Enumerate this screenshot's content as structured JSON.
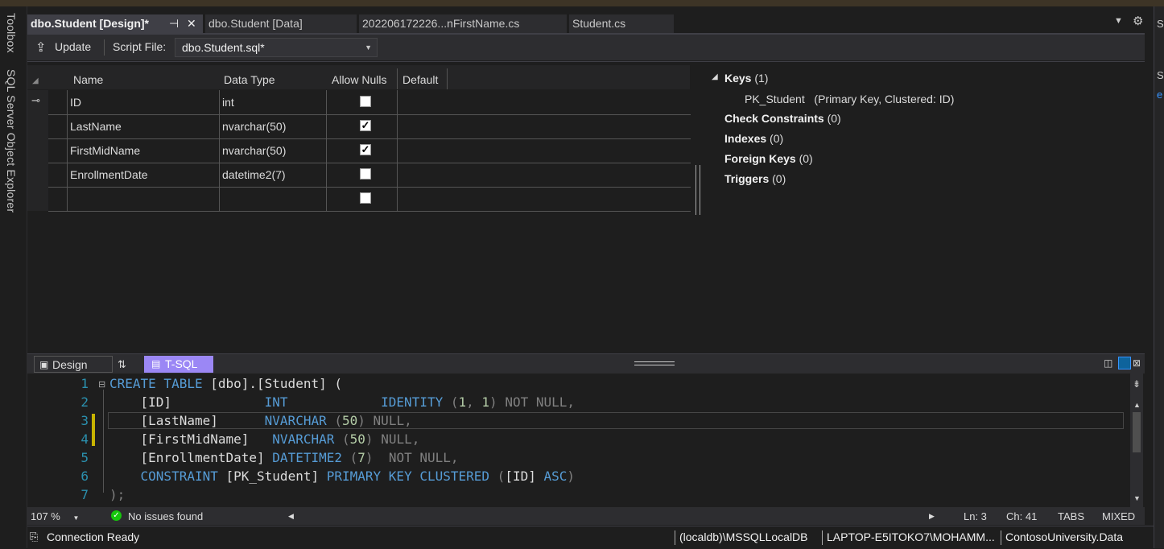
{
  "sidebar_left": {
    "toolbox": "Toolbox",
    "sql_explorer": "SQL Server Object Explorer"
  },
  "tabs": [
    {
      "label": "dbo.Student [Design]*"
    },
    {
      "label": "dbo.Student [Data]"
    },
    {
      "label": "202206172226...nFirstName.cs"
    },
    {
      "label": "Student.cs"
    }
  ],
  "toolbar": {
    "update_label": "Update",
    "script_file_label": "Script File:",
    "script_file_value": "dbo.Student.sql*"
  },
  "grid": {
    "columns": [
      "Name",
      "Data Type",
      "Allow Nulls",
      "Default"
    ],
    "rows": [
      {
        "name": "ID",
        "type": "int",
        "allow_nulls": false,
        "key": true
      },
      {
        "name": "LastName",
        "type": "nvarchar(50)",
        "allow_nulls": true
      },
      {
        "name": "FirstMidName",
        "type": "nvarchar(50)",
        "allow_nulls": true
      },
      {
        "name": "EnrollmentDate",
        "type": "datetime2(7)",
        "allow_nulls": false
      },
      {
        "name": "",
        "type": "",
        "allow_nulls": false
      }
    ]
  },
  "properties": {
    "keys_label": "Keys",
    "keys_count": "(1)",
    "pk_name": "PK_Student",
    "pk_desc": "(Primary Key, Clustered: ID)",
    "check_label": "Check Constraints",
    "check_count": "(0)",
    "indexes_label": "Indexes",
    "indexes_count": "(0)",
    "fk_label": "Foreign Keys",
    "fk_count": "(0)",
    "triggers_label": "Triggers",
    "triggers_count": "(0)"
  },
  "pane_tabs": {
    "design": "Design",
    "tsql": "T-SQL"
  },
  "code": {
    "line_numbers": [
      "1",
      "2",
      "3",
      "4",
      "5",
      "6",
      "7"
    ],
    "l1": {
      "kw": "CREATE TABLE",
      "rest": " [dbo].[Student] ("
    },
    "l2": {
      "col": "[ID]",
      "type": "INT",
      "rest": "IDENTITY",
      "n1": "1",
      "n2": "1",
      "tail": "NOT NULL,"
    },
    "l3": {
      "col": "[LastName]",
      "type": "NVARCHAR",
      "n": "50",
      "tail": "NULL,"
    },
    "l4": {
      "col": "[FirstMidName]",
      "type": "NVARCHAR",
      "n": "50",
      "tail": "NULL,"
    },
    "l5": {
      "col": "[EnrollmentDate]",
      "type": "DATETIME2",
      "n": "7",
      "tail": "NOT NULL,"
    },
    "l6": {
      "kw1": "CONSTRAINT",
      "name": "[PK_Student]",
      "kw2": "PRIMARY KEY CLUSTERED",
      "col": "[ID]",
      "kw3": "ASC"
    },
    "l7": ");"
  },
  "editor_status": {
    "zoom": "107 %",
    "issues": "No issues found",
    "ln": "Ln: 3",
    "ch": "Ch: 41",
    "tabs": "TABS",
    "mixed": "MIXED"
  },
  "status": {
    "ready": "Connection Ready",
    "server": "(localdb)\\MSSQLLocalDB",
    "user": "LAPTOP-E5ITOKO7\\MOHAMM...",
    "db": "ContosoUniversity.Data"
  },
  "colors": {
    "accent": "#9b87f5",
    "keyword": "#569cd6",
    "linenum": "#2b91af",
    "ok": "#16c60c"
  }
}
